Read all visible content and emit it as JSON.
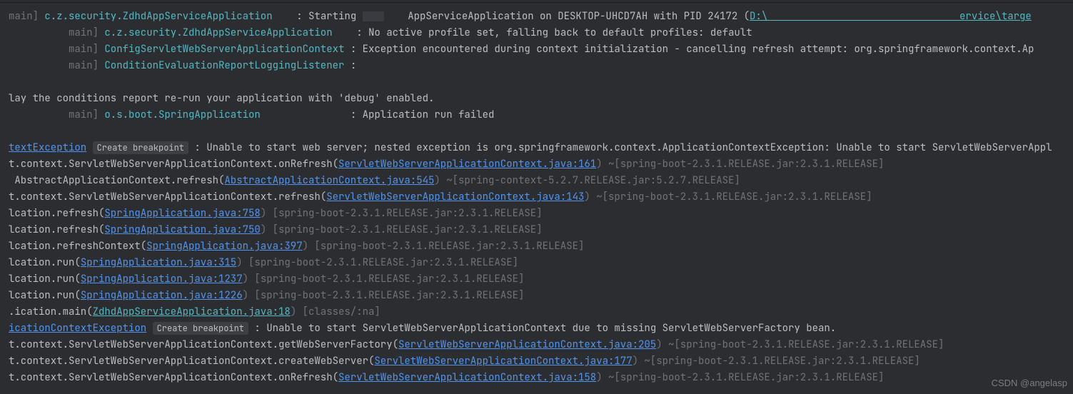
{
  "log": {
    "startup": [
      {
        "thread": "main]",
        "logger": "c.z.security.ZdhdAppServiceApplication",
        "msg_pre": ": Starting ",
        "app": "    AppServiceApplication",
        "msg_mid": " on DESKTOP-UHCD7AH with PID 24172 (",
        "path": "D:\\                                ervice\\targe"
      },
      {
        "thread": "main]",
        "logger": "c.z.security.ZdhdAppServiceApplication",
        "msg": ": No active profile set, falling back to default profiles: default"
      },
      {
        "thread": "main]",
        "logger": "ConfigServletWebServerApplicationContext",
        "msg": ": Exception encountered during context initialization - cancelling refresh attempt: org.springframework.context.Ap"
      },
      {
        "thread": "main]",
        "logger": "ConditionEvaluationReportLoggingListener",
        "msg": ":"
      }
    ],
    "report": "lay the conditions report re-run your application with 'debug' enabled.",
    "fail": {
      "thread": "main]",
      "logger": "o.s.boot.SpringApplication",
      "msg": ": Application run failed"
    },
    "breakpoint_label": "Create breakpoint",
    "ex1": {
      "name": "textException",
      "msg": " : Unable to start web server; nested exception is org.springframework.context.ApplicationContextException: Unable to start ServletWebServerAppl"
    },
    "trace1": [
      {
        "pre": "t.context.ServletWebServerApplicationContext.onRefresh(",
        "link": "ServletWebServerApplicationContext.java:161",
        "post": ") ~[spring-boot-2.3.1.RELEASE.jar:2.3.1.RELEASE]"
      },
      {
        "pre": " AbstractApplicationContext.refresh(",
        "link": "AbstractApplicationContext.java:545",
        "post": ") ~[spring-context-5.2.7.RELEASE.jar:5.2.7.RELEASE]"
      },
      {
        "pre": "t.context.ServletWebServerApplicationContext.refresh(",
        "link": "ServletWebServerApplicationContext.java:143",
        "post": ") ~[spring-boot-2.3.1.RELEASE.jar:2.3.1.RELEASE]"
      },
      {
        "pre": "lcation.refresh(",
        "link": "SpringApplication.java:758",
        "post": ") [spring-boot-2.3.1.RELEASE.jar:2.3.1.RELEASE]"
      },
      {
        "pre": "lcation.refresh(",
        "link": "SpringApplication.java:750",
        "post": ") [spring-boot-2.3.1.RELEASE.jar:2.3.1.RELEASE]"
      },
      {
        "pre": "lcation.refreshContext(",
        "link": "SpringApplication.java:397",
        "post": ") [spring-boot-2.3.1.RELEASE.jar:2.3.1.RELEASE]"
      },
      {
        "pre": "lcation.run(",
        "link": "SpringApplication.java:315",
        "post": ") [spring-boot-2.3.1.RELEASE.jar:2.3.1.RELEASE]"
      },
      {
        "pre": "lcation.run(",
        "link": "SpringApplication.java:1237",
        "post": ") [spring-boot-2.3.1.RELEASE.jar:2.3.1.RELEASE]"
      },
      {
        "pre": "lcation.run(",
        "link": "SpringApplication.java:1226",
        "post": ") [spring-boot-2.3.1.RELEASE.jar:2.3.1.RELEASE]"
      },
      {
        "pre": ".ication.main(",
        "link": "ZdhdAppServiceApplication.java:18",
        "post": ") [classes/:na]",
        "link_cyan": true
      }
    ],
    "ex2": {
      "name": "icationContextException",
      "msg": " : Unable to start ServletWebServerApplicationContext due to missing ServletWebServerFactory bean."
    },
    "trace2": [
      {
        "pre": "t.context.ServletWebServerApplicationContext.getWebServerFactory(",
        "link": "ServletWebServerApplicationContext.java:205",
        "post": ") ~[spring-boot-2.3.1.RELEASE.jar:2.3.1.RELEASE]"
      },
      {
        "pre": "t.context.ServletWebServerApplicationContext.createWebServer(",
        "link": "ServletWebServerApplicationContext.java:177",
        "post": ") ~[spring-boot-2.3.1.RELEASE.jar:2.3.1.RELEASE]"
      },
      {
        "pre": "t.context.ServletWebServerApplicationContext.onRefresh(",
        "link": "ServletWebServerApplicationContext.java:158",
        "post": ") ~[spring-boot-2.3.1.RELEASE.jar:2.3.1.RELEASE]"
      }
    ]
  },
  "watermark": "CSDN @angelasp"
}
